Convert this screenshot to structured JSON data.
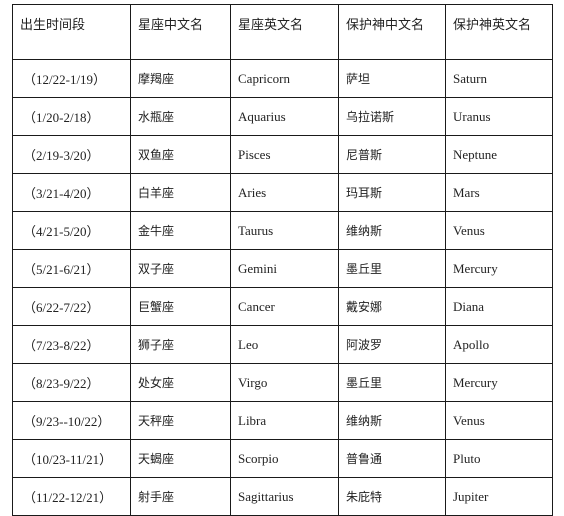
{
  "table": {
    "headers": [
      "出生时间段",
      "星座中文名",
      "星座英文名",
      "保护神中文名",
      "保护神英文名"
    ],
    "rows": [
      {
        "period": "（12/22-1/19）",
        "sign_cn": "摩羯座",
        "sign_en": "Capricorn",
        "god_cn": "萨坦",
        "god_en": "Saturn"
      },
      {
        "period": "（1/20-2/18）",
        "sign_cn": "水瓶座",
        "sign_en": "Aquarius",
        "god_cn": "乌拉诺斯",
        "god_en": "Uranus"
      },
      {
        "period": "（2/19-3/20）",
        "sign_cn": "双鱼座",
        "sign_en": "Pisces",
        "god_cn": "尼普斯",
        "god_en": "Neptune"
      },
      {
        "period": "（3/21-4/20）",
        "sign_cn": "白羊座",
        "sign_en": "Aries",
        "god_cn": "玛耳斯",
        "god_en": "Mars"
      },
      {
        "period": "（4/21-5/20）",
        "sign_cn": "金牛座",
        "sign_en": "Taurus",
        "god_cn": "维纳斯",
        "god_en": "Venus"
      },
      {
        "period": "（5/21-6/21）",
        "sign_cn": "双子座",
        "sign_en": "Gemini",
        "god_cn": "墨丘里",
        "god_en": "Mercury"
      },
      {
        "period": "（6/22-7/22）",
        "sign_cn": "巨蟹座",
        "sign_en": "Cancer",
        "god_cn": "戴安娜",
        "god_en": "Diana"
      },
      {
        "period": "（7/23-8/22）",
        "sign_cn": "狮子座",
        "sign_en": "Leo",
        "god_cn": "阿波罗",
        "god_en": "Apollo"
      },
      {
        "period": "（8/23-9/22）",
        "sign_cn": "处女座",
        "sign_en": "Virgo",
        "god_cn": "墨丘里",
        "god_en": "Mercury"
      },
      {
        "period": "（9/23--10/22）",
        "sign_cn": "天秤座",
        "sign_en": "Libra",
        "god_cn": "维纳斯",
        "god_en": "Venus"
      },
      {
        "period": "（10/23-11/21）",
        "sign_cn": "天蝎座",
        "sign_en": "Scorpio",
        "god_cn": "普鲁通",
        "god_en": "Pluto"
      },
      {
        "period": "（11/22-12/21）",
        "sign_cn": "射手座",
        "sign_en": "Sagittarius",
        "god_cn": "朱庇特",
        "god_en": "Jupiter"
      }
    ]
  }
}
